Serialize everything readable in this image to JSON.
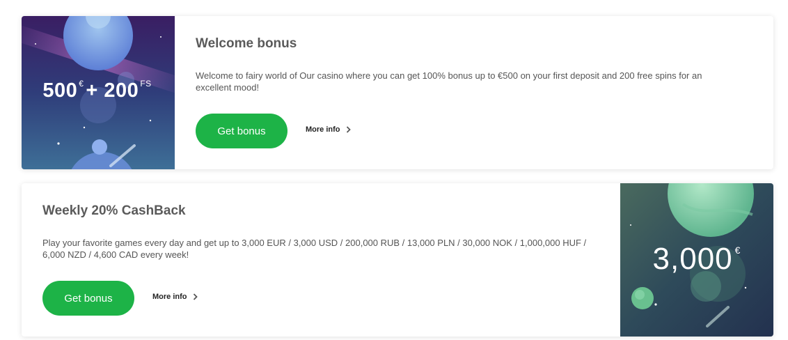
{
  "offers": [
    {
      "title": "Welcome bonus",
      "description": "Welcome to fairy world of Our casino where you can get 100% bonus up to €500 on your first deposit and 200 free spins for an excellent mood!",
      "button_label": "Get bonus",
      "more_label": "More info",
      "art": {
        "amount": "500",
        "currency": "€",
        "plus": "+",
        "spins": "200",
        "spins_unit": "FS"
      }
    },
    {
      "title": "Weekly 20% CashBack",
      "description": "Play your favorite games every day and get up to 3,000 EUR / 3,000 USD / 200,000 RUB / 13,000 PLN / 30,000 NOK / 1,000,000 HUF / 6,000 NZD / 4,600 CAD every week!",
      "button_label": "Get bonus",
      "more_label": "More info",
      "art": {
        "amount": "3,000",
        "currency": "€"
      }
    }
  ],
  "colors": {
    "accent": "#1db347",
    "title": "#5a5a5a",
    "text": "#555555"
  },
  "icons": [
    "chevron-right-icon"
  ]
}
